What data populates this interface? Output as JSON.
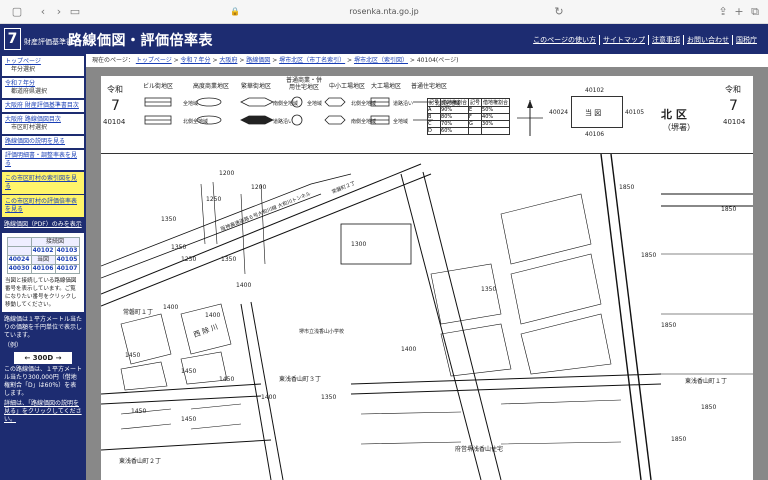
{
  "browser": {
    "url": "rosenka.nta.go.jp"
  },
  "header": {
    "logo_number": "7",
    "subtitle": "財産評価基準書",
    "title": "路線価図・評価倍率表",
    "nav": [
      "このページの使い方",
      "サイトマップ",
      "注意事項",
      "お問い合わせ",
      "国税庁"
    ]
  },
  "sidebar": {
    "top_link": "トップページ",
    "top_sub": "年分選択",
    "year_link": "令和７年分",
    "year_sub": "都道府県選択",
    "pref_link": "大阪府 財産評価基準書目次",
    "pref_map_link": "大阪府 路線価図目次",
    "pref_map_sub": "市区町村選択",
    "explain_link": "路線価図の説明を見る",
    "adjust_link": "評価明細書・調整率表を見る",
    "index_map_link": "この市区町村の索引図を見る",
    "ratio_link": "この市区町村の評価倍率表を見る",
    "pdf_button": "路線価図（PDF）のみを表示",
    "adjacent_title": "接続図",
    "adjacent": [
      [
        "",
        "40102",
        "40103"
      ],
      [
        "40024",
        "当図",
        "40105"
      ],
      [
        "40030",
        "40106",
        "40107"
      ]
    ],
    "adjacent_note": "当図と接続している路線価図番号を表示しています。ご覧になりたい番号をクリックし移動してください。",
    "price_note": "路線価は１平方メートル当たりの価額を千円単位で表示しています。",
    "example_label": "（例）",
    "example_value": "← 300D →",
    "example_note": "この路線価は、１平方メートル当たり300,000円（借地権割合「D」は60％）を表します。",
    "detail_note": "詳細は、「路線価図の説明を見る」をクリックしてください。"
  },
  "breadcrumb": {
    "prefix": "現在のページ：",
    "items": [
      "トップページ",
      "令和７年分",
      "大阪府",
      "路線価図",
      "堺市北区（市丁名索引）",
      "堺市北区（索引図）"
    ],
    "current": "40104(ページ)"
  },
  "map": {
    "era": "令和",
    "year": "7",
    "sheet": "40104",
    "ward": "北 区",
    "office": "（堺署）",
    "legend_districts": [
      "ビル街地区",
      "高度商業地区",
      "繁華街地区",
      "普通商業・併用住宅地区",
      "中小工場地区",
      "大工場地区",
      "普通住宅地区"
    ],
    "legend_sub": [
      "全地域",
      "北側全地域",
      "南側全地域",
      "道路沿い",
      "全地域",
      "北側全地域",
      "南側全地域",
      "道路沿い",
      "全地域",
      "北側全地域",
      "南側全地域",
      "道路沿い",
      "全地域",
      "北側全地域"
    ],
    "ratio_header": [
      "記号",
      "借地権割合",
      "記号",
      "借地権割合"
    ],
    "ratio_rows": [
      [
        "A",
        "90%",
        "E",
        "50%"
      ],
      [
        "B",
        "80%",
        "F",
        "40%"
      ],
      [
        "C",
        "70%",
        "G",
        "30%"
      ],
      [
        "D",
        "60%",
        "",
        ""
      ]
    ],
    "index_top": "40102",
    "index_left": "40024",
    "index_center": "当 図",
    "index_right": "40105",
    "index_bottom": "40106",
    "places": [
      "常磐町１丁",
      "西 除 川",
      "東浅香山町３丁",
      "東浅香山町１丁",
      "東浅香山町２丁",
      "府営堺浅香山住宅",
      "堺市立浅香山小学校",
      "阪神高速道路６号大和川線 大和川トンネル",
      "常磐町２丁"
    ],
    "prices": [
      "1200",
      "1200",
      "1250",
      "1350",
      "1350",
      "1350",
      "1400",
      "1400",
      "1400",
      "1450",
      "1450",
      "1450",
      "1450",
      "1450",
      "1400",
      "1350",
      "1850",
      "1850",
      "1850",
      "1850",
      "1850",
      "1850",
      "1350",
      "1300",
      "1400",
      "1250"
    ]
  }
}
